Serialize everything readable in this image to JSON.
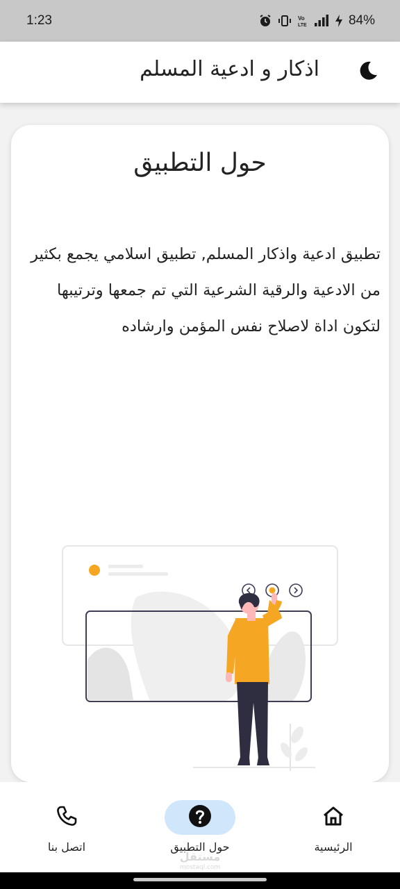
{
  "status_bar": {
    "time": "1:23",
    "battery": "84%",
    "icons": [
      "alarm-icon",
      "vibrate-icon",
      "volte-icon",
      "signal-icon",
      "charging-icon"
    ]
  },
  "app_bar": {
    "title": "اذكار و ادعية المسلم",
    "theme_icon": "moon-icon"
  },
  "card": {
    "title": "حول التطبيق",
    "body": "تطبيق ادعية واذكار المسلم, تطبيق اسلامي يجمع بكثير من الادعية والرقية الشرعية التي تم جمعها وترتيبها لتكون اداة لاصلاح نفس المؤمن وارشاده",
    "illustration": "person-pressing-slider-buttons-illustration"
  },
  "bottom_nav": {
    "items": [
      {
        "label": "الرئيسية",
        "icon": "home-icon",
        "active": false
      },
      {
        "label": "حول التطبيق",
        "icon": "question-icon",
        "active": true
      },
      {
        "label": "اتصل بنا",
        "icon": "phone-icon",
        "active": false
      }
    ]
  },
  "watermark": {
    "text": "مستقل",
    "sub": "mostaql.com"
  },
  "colors": {
    "accent": "#f5a623",
    "active_pill": "#cfe6fb",
    "status_bar_bg": "#c8c8c8",
    "dark_figure": "#2f2e41"
  }
}
